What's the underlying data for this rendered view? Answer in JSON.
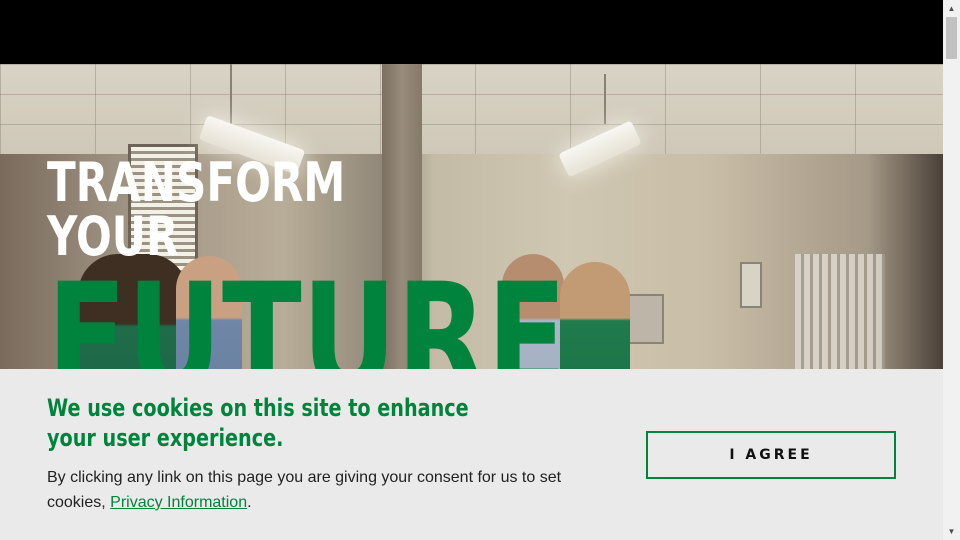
{
  "hero": {
    "headline_line1": "TRANSFORM",
    "headline_line2": "YOUR",
    "headline_accent": "FUTURE",
    "accent_color": "#00843d"
  },
  "cookie_banner": {
    "title": "We use cookies on this site to enhance your user experience.",
    "body": "By clicking any link on this page you are giving your consent for us to set cookies,",
    "link_label": "Privacy Information",
    "body_end": ".",
    "agree_label": "I AGREE",
    "background": "#eaeaea"
  },
  "scrollbar": {
    "up_icon": "chevron-up-icon",
    "down_icon": "chevron-down-icon"
  }
}
